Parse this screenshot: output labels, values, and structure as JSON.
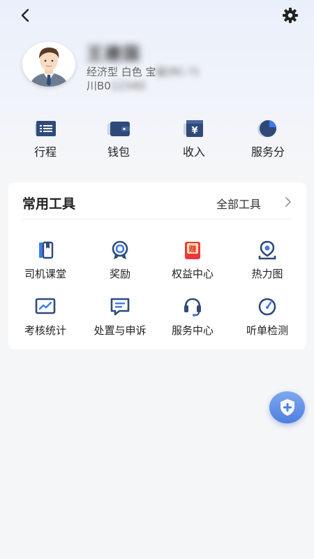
{
  "header": {
    "back_icon": "chevron-left-icon",
    "settings_icon": "gear-icon"
  },
  "profile": {
    "name": "王建国",
    "car_info": "经济型 白色 宝骏(RC-7)",
    "car_info_visible": "经济型 白色 宝",
    "car_info_blurred": "骏(RC-7)",
    "plate_visible": "川B0",
    "plate_blurred": "1234D"
  },
  "quick": [
    {
      "label": "行程",
      "icon": "itinerary-list-icon"
    },
    {
      "label": "钱包",
      "icon": "wallet-icon"
    },
    {
      "label": "收入",
      "icon": "income-yen-icon"
    },
    {
      "label": "服务分",
      "icon": "pie-score-icon"
    }
  ],
  "tools": {
    "title": "常用工具",
    "all_label": "全部工具",
    "items": [
      {
        "label": "司机课堂",
        "icon": "book-icon"
      },
      {
        "label": "奖励",
        "icon": "medal-icon"
      },
      {
        "label": "权益中心",
        "icon": "red-envelope-icon",
        "badge": "赚"
      },
      {
        "label": "热力图",
        "icon": "location-pin-icon"
      },
      {
        "label": "考核统计",
        "icon": "chart-screen-icon"
      },
      {
        "label": "处置与申诉",
        "icon": "message-icon"
      },
      {
        "label": "服务中心",
        "icon": "headset-icon"
      },
      {
        "label": "听单检测",
        "icon": "gauge-icon"
      }
    ]
  },
  "fab": {
    "icon": "shield-plus-icon"
  },
  "colors": {
    "accent": "#3a5a9c",
    "icon_dark": "#2f4a7a",
    "icon_blue": "#3d7be8",
    "red": "#e8383d"
  }
}
